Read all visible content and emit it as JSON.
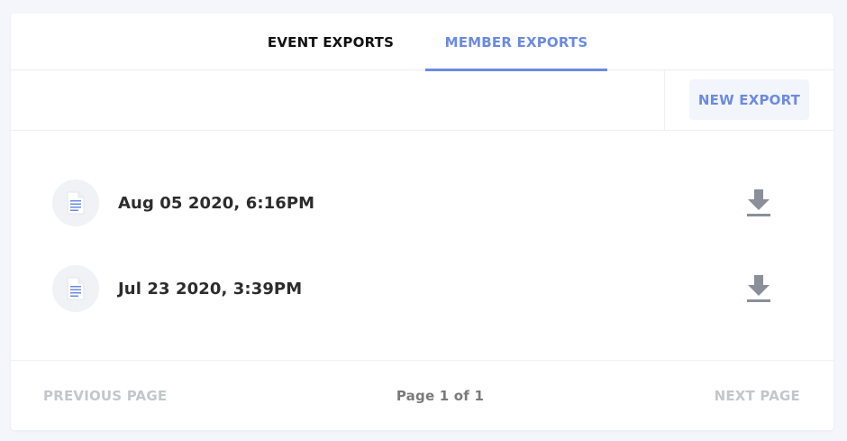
{
  "colors": {
    "accent": "#6b8be2",
    "accent_bg": "#f3f5fc",
    "icon_gray": "#8a8f9a"
  },
  "tabs": [
    {
      "label": "EVENT EXPORTS",
      "active": false
    },
    {
      "label": "MEMBER EXPORTS",
      "active": true
    }
  ],
  "toolbar": {
    "new_export_label": "NEW EXPORT"
  },
  "exports": [
    {
      "date": "Aug 05 2020, 6:16PM",
      "file_icon": "document-icon",
      "action_icon": "download-icon"
    },
    {
      "date": "Jul 23 2020, 3:39PM",
      "file_icon": "document-icon",
      "action_icon": "download-icon"
    }
  ],
  "pagination": {
    "previous_label": "PREVIOUS PAGE",
    "page_info": "Page 1 of 1",
    "next_label": "NEXT PAGE"
  }
}
